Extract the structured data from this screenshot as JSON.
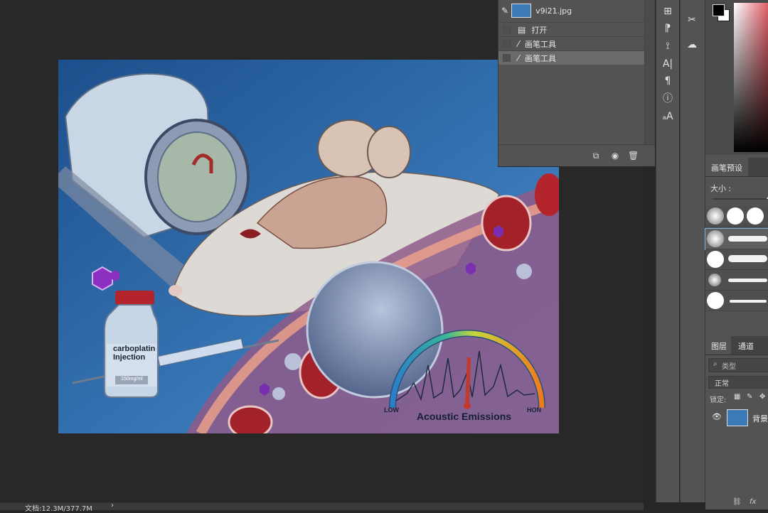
{
  "history": {
    "snapshot_name": "v9i21.jpg",
    "items": [
      {
        "label": "打开",
        "icon": "document-icon",
        "selected": false
      },
      {
        "label": "画笔工具",
        "icon": "brush-icon",
        "selected": false
      },
      {
        "label": "画笔工具",
        "icon": "brush-icon",
        "selected": true
      }
    ],
    "footer_icons": [
      "new-document-from-state-icon",
      "camera-icon",
      "trash-icon"
    ]
  },
  "artwork": {
    "vial_label_line1": "carboplatin",
    "vial_label_line2": "Injection",
    "vial_dose": "150mg/ml",
    "gauge_low": "LOW",
    "gauge_high": "HON",
    "gauge_title": "Acoustic Emissions"
  },
  "brush_presets": {
    "tab_label": "画笔预设",
    "size_label": "大小 :"
  },
  "layers": {
    "tabs": [
      "图层",
      "通道"
    ],
    "search_placeholder": "类型",
    "blend_mode": "正常",
    "lock_label": "锁定:",
    "layer_name": "背景"
  },
  "status": {
    "doc_info": "文档:12.3M/377.7M",
    "arrow": "›"
  },
  "colors": {
    "panel_bg": "#535353",
    "canvas_bg": "#282828",
    "selected_row": "#6a6a6a",
    "artwork_blue": "#2f6fb0"
  }
}
